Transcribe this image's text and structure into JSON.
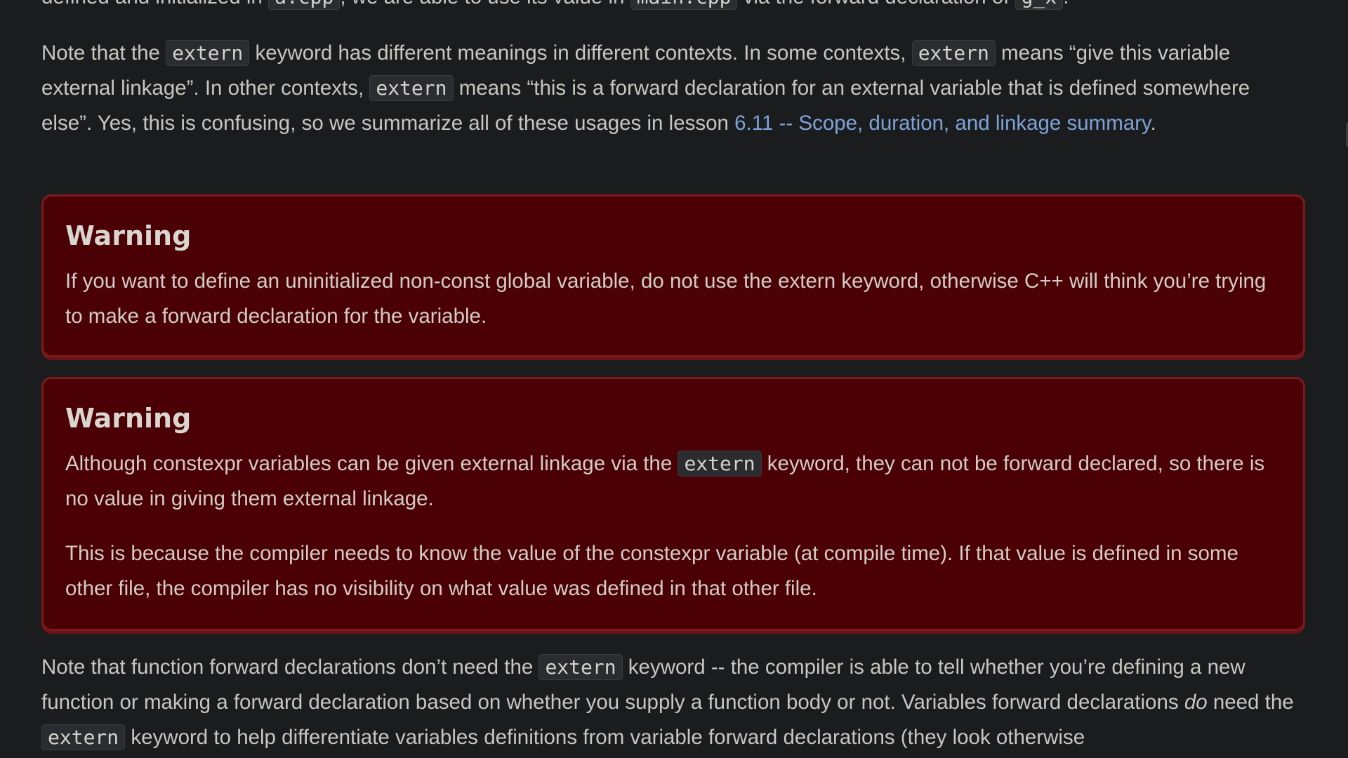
{
  "top_cut": {
    "text_1": "defined and initialized in ",
    "code_1": "a.cpp",
    "text_2": ", we are able to use its value in ",
    "code_2": "main.cpp",
    "text_3": " via the forward declaration of ",
    "code_3": "g_x",
    "text_4": "."
  },
  "para1": {
    "t1": "Note that the ",
    "c1": "extern",
    "t2": " keyword has different meanings in different contexts. In some contexts, ",
    "c2": "extern",
    "t3": " means “give this variable external linkage”. In other contexts, ",
    "c3": "extern",
    "t4": " means “this is a forward declaration for an external variable that is defined somewhere else”. Yes, this is confusing, so we summarize all of these usages in lesson ",
    "link": "6.11 -- Scope, duration, and linkage summary",
    "t5": "."
  },
  "warning1": {
    "title": "Warning",
    "body": "If you want to define an uninitialized non-const global variable, do not use the extern keyword, otherwise C++ will think you’re trying to make a forward declaration for the variable."
  },
  "warning2": {
    "title": "Warning",
    "p1_t1": "Although constexpr variables can be given external linkage via the ",
    "p1_c1": "extern",
    "p1_t2": " keyword, they can not be forward declared, so there is no value in giving them external linkage.",
    "p2": "This is because the compiler needs to know the value of the constexpr variable (at compile time). If that value is defined in some other file, the compiler has no visibility on what value was defined in that other file."
  },
  "para_last": {
    "t1": "Note that function forward declarations don’t need the ",
    "c1": "extern",
    "t2": " keyword -- the compiler is able to tell whether you’re defining a new function or making a forward declaration based on whether you supply a function body or not. Variables forward declarations ",
    "em": "do",
    "t3": " need the ",
    "c2": "extern",
    "t4": " keyword to help differentiate variables definitions from variable forward declarations (they look otherwise"
  },
  "colors": {
    "page_bg": "#1b1c1e",
    "warning_bg": "#4a0004",
    "warning_border": "#7c1a20",
    "link": "#7da3d8"
  }
}
